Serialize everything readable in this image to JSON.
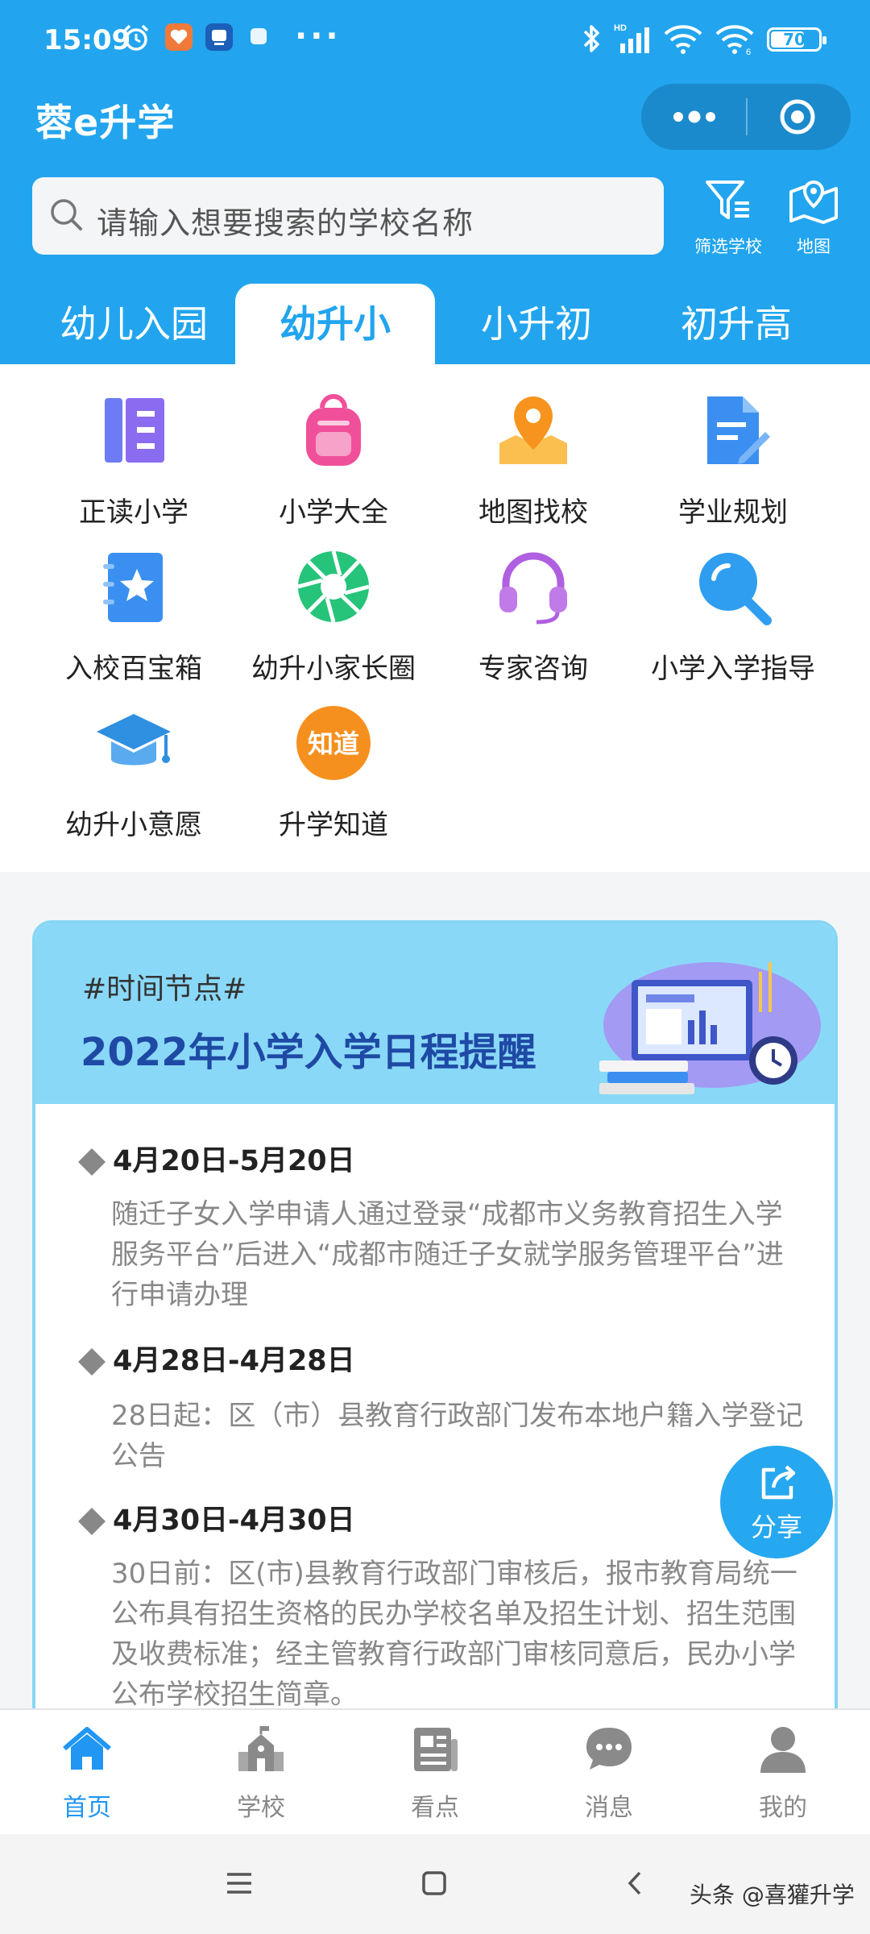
{
  "status_bar": {
    "time": "15:09",
    "dots": "···",
    "battery": "70",
    "battery_level": 0.7
  },
  "header": {
    "app_title": "蓉e升学",
    "search_placeholder": "请输入想要搜索的学校名称",
    "filter_label": "筛选学校",
    "map_label": "地图"
  },
  "tabs": [
    {
      "label": "幼儿入园",
      "active": false
    },
    {
      "label": "幼升小",
      "active": true
    },
    {
      "label": "小升初",
      "active": false
    },
    {
      "label": "初升高",
      "active": false
    }
  ],
  "grid": [
    {
      "label": "正读小学",
      "icon": "book-columns-icon",
      "color": "#7b6cf0"
    },
    {
      "label": "小学大全",
      "icon": "backpack-icon",
      "color": "#f0509a"
    },
    {
      "label": "地图找校",
      "icon": "map-pin-icon",
      "color": "#f7a023"
    },
    {
      "label": "学业规划",
      "icon": "document-edit-icon",
      "color": "#3b8ff0"
    },
    {
      "label": "入校百宝箱",
      "icon": "star-notebook-icon",
      "color": "#3b8ff0"
    },
    {
      "label": "幼升小家长圈",
      "icon": "aperture-icon",
      "color": "#25c47a"
    },
    {
      "label": "专家咨询",
      "icon": "headset-icon",
      "color": "#b05fe0"
    },
    {
      "label": "小学入学指导",
      "icon": "search-guide-icon",
      "color": "#2f9ef0"
    },
    {
      "label": "幼升小意愿",
      "icon": "graduation-cap-icon",
      "color": "#2f8fe0"
    },
    {
      "label": "升学知道",
      "icon": "zhidao-badge-icon",
      "color": "#f5901e",
      "badge_text": "知道"
    }
  ],
  "card": {
    "tag": "#时间节点#",
    "title": "2022年小学入学日程提醒",
    "entries": [
      {
        "date": "4月20日-5月20日",
        "desc": "随迁子女入学申请人通过登录“成都市义务教育招生入学服务平台”后进入“成都市随迁子女就学服务管理平台”进行申请办理"
      },
      {
        "date": "4月28日-4月28日",
        "desc": "28日起：区（市）县教育行政部门发布本地户籍入学登记公告"
      },
      {
        "date": "4月30日-4月30日",
        "desc": "30日前：区(市)县教育行政部门审核后，报市教育局统一公布具有招生资格的民办学校名单及招生计划、招生范围及收费标准；经主管教育行政部门审核同意后，民办小学公布学校招生简章。"
      }
    ]
  },
  "share_label": "分享",
  "bottom_nav": [
    {
      "label": "首页",
      "icon": "home-icon",
      "active": true
    },
    {
      "label": "学校",
      "icon": "school-icon",
      "active": false
    },
    {
      "label": "看点",
      "icon": "news-icon",
      "active": false
    },
    {
      "label": "消息",
      "icon": "message-icon",
      "active": false
    },
    {
      "label": "我的",
      "icon": "user-icon",
      "active": false
    }
  ],
  "watermark": "头条 @喜獾升学",
  "colors": {
    "brand": "#22a5ee",
    "card_title": "#1e4aa5",
    "nav_active": "#2196f3"
  }
}
